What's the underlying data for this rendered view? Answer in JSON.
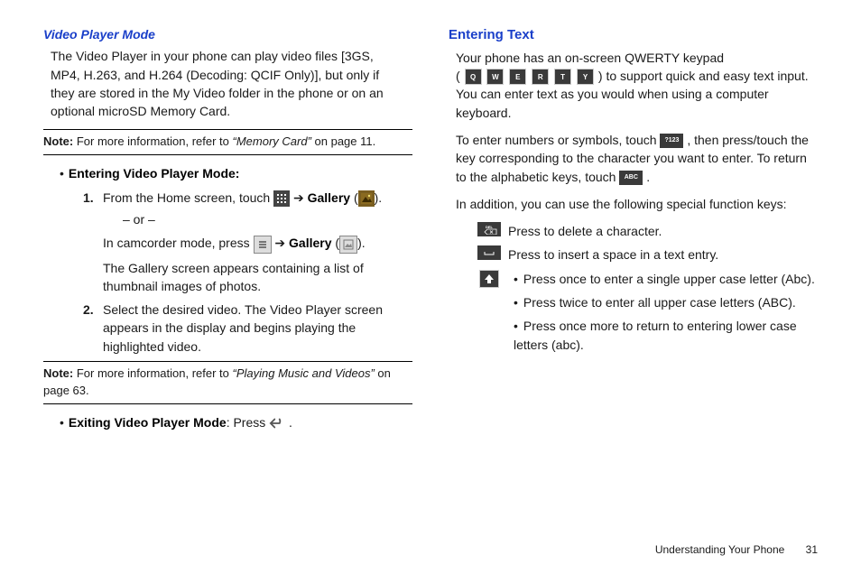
{
  "left": {
    "subTitle": "Video Player Mode",
    "intro": "The Video Player in your phone can play video files [3GS, MP4, H.263, and H.264 (Decoding: QCIF Only)], but only if they are stored in the My Video folder in the phone or on an optional microSD Memory Card.",
    "note1": {
      "prefix": "Note:",
      "body": " For more information, refer to ",
      "ref": "“Memory Card”",
      "tail": "  on page 11."
    },
    "bulletEnter": "Entering Video Player Mode:",
    "step1": {
      "num": "1.",
      "a": "From the Home screen, ",
      "touch": "touch",
      "arrow": " ➔ ",
      "gallery": "Gallery",
      "tail": " (",
      "close": ")."
    },
    "or": "– or –",
    "step1b": {
      "a": "In camcorder mode, press ",
      "arrow": " ➔ ",
      "gallery": "Gallery",
      "tail": " (",
      "close": ")."
    },
    "step1c": "The Gallery screen appears containing a list of thumbnail images of photos.",
    "step2": {
      "num": "2.",
      "text": "Select the desired video. The Video Player screen appears in the display and begins playing the highlighted video."
    },
    "note2": {
      "prefix": "Note:",
      "body": " For more information, refer to ",
      "ref": "“Playing Music and Videos”",
      "tail": "  on page 63."
    },
    "bulletExit": {
      "label": "Exiting Video Player Mode",
      "tail": ": Press ",
      " period": " ."
    }
  },
  "right": {
    "title": "Entering Text",
    "p1a": "Your phone has an on-screen QWERTY keypad",
    "p1b_open": "(",
    "keys": [
      "Q",
      "W",
      "E",
      "R",
      "T",
      "Y"
    ],
    "p1b_close": ") to support quick and easy text input. You can enter text as you would when using a computer keyboard.",
    "p2a": "To enter numbers or symbols, touch ",
    "p2_key1": "?123",
    "p2b": " , then press/touch the key corresponding to the character you want to enter. To return to the alphabetic keys, touch ",
    "p2_key2": "ABC",
    "p2c": " .",
    "p3": "In addition, you can use the following special function keys:",
    "fn1": "Press to delete a character.",
    "fn2": "Press to insert a space in a text entry.",
    "fn3": [
      "Press once to enter a single upper case letter (Abc).",
      "Press twice to enter all upper case letters (ABC).",
      "Press once more to return to entering lower case letters (abc)."
    ]
  },
  "footer": {
    "section": "Understanding Your Phone",
    "page": "31"
  }
}
